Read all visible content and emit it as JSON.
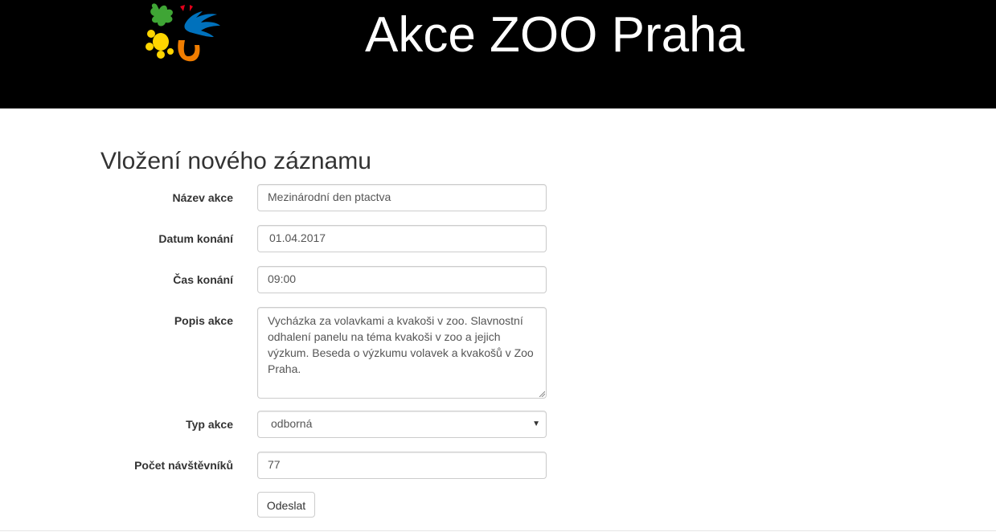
{
  "header": {
    "title": "Akce ZOO Praha"
  },
  "form": {
    "heading": "Vložení nového záznamu",
    "fields": [
      {
        "label": "Název akce",
        "value": "Mezinárodní den ptactva"
      },
      {
        "label": "Datum konání",
        "value": "01.04.2017"
      },
      {
        "label": "Čas konání",
        "value": "09:00"
      },
      {
        "label": "Popis akce",
        "value": "Vycházka za volavkami a kvakoši v zoo. Slavnostní odhalení panelu na téma kvakoši v zoo a jejich výzkum. Beseda o výzkumu volavek a kvakošů v Zoo Praha."
      },
      {
        "label": "Typ akce",
        "value": "odborná"
      },
      {
        "label": "Počet návštěvníků",
        "value": "77"
      }
    ],
    "submit_label": "Odeslat"
  },
  "colors": {
    "header_bg": "#000000",
    "header_text": "#ffffff",
    "border": "#cccccc"
  },
  "icons": {
    "logo": "zoo-praha-logo-icon",
    "select_caret": "caret-down-icon",
    "resize": "resize-grip-icon"
  }
}
